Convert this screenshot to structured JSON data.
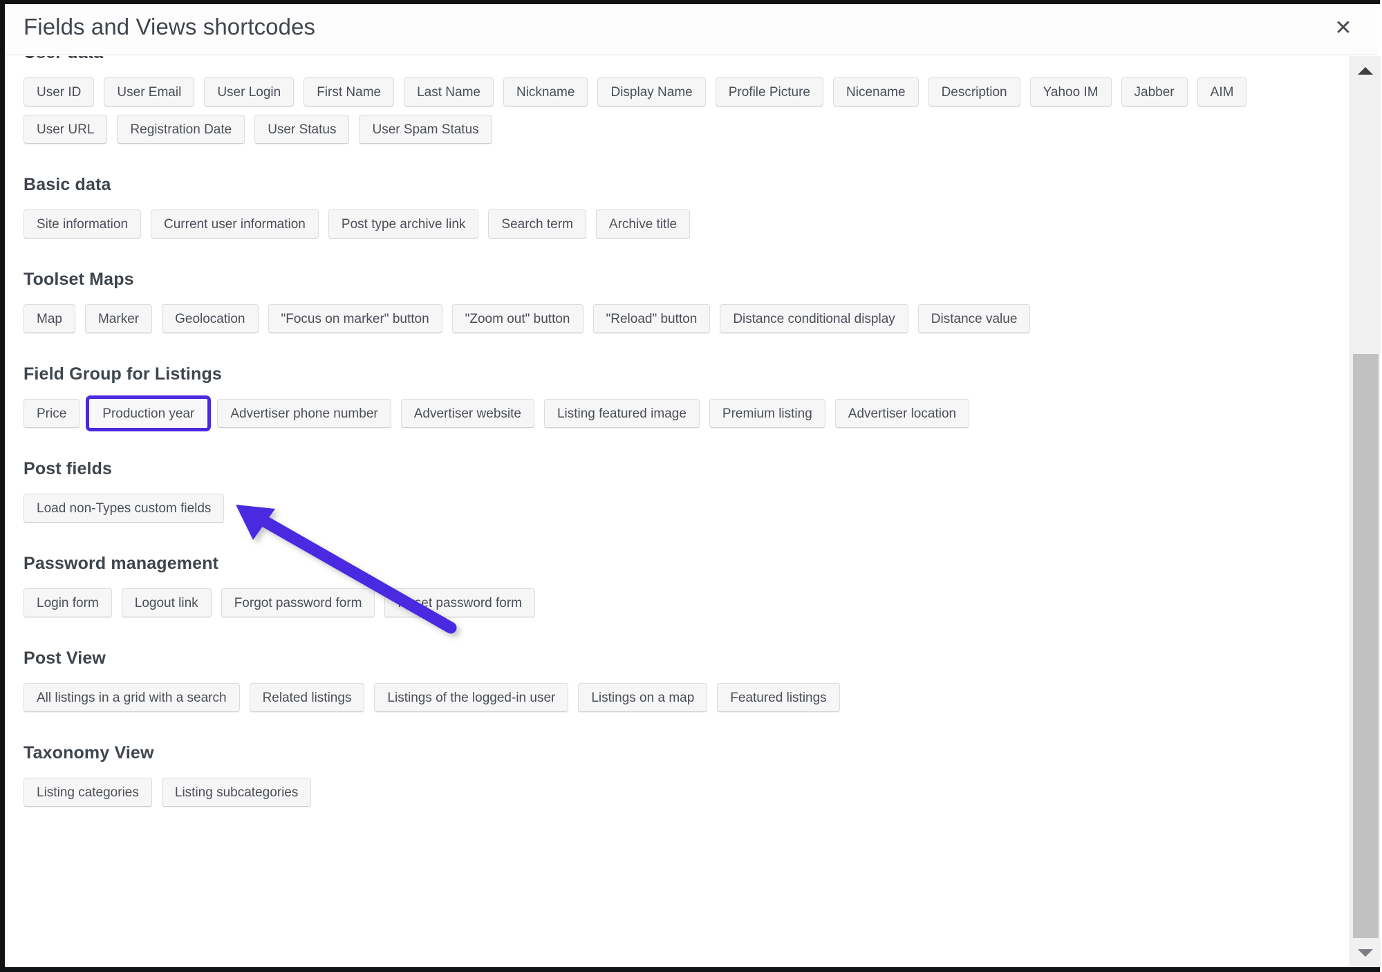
{
  "modal": {
    "title": "Fields and Views shortcodes",
    "close_label": "✕",
    "close_icon": "close-icon"
  },
  "scrollbar": {
    "up_icon": "chevron-up-icon",
    "down_icon": "chevron-down-icon"
  },
  "annotation": {
    "highlight_color": "#4a29e0",
    "arrow_color": "#4a29e0",
    "highlighted_button": "Production year"
  },
  "sections": [
    {
      "title": "User data",
      "buttons": [
        "User ID",
        "User Email",
        "User Login",
        "First Name",
        "Last Name",
        "Nickname",
        "Display Name",
        "Profile Picture",
        "Nicename",
        "Description",
        "Yahoo IM",
        "Jabber",
        "AIM",
        "User URL",
        "Registration Date",
        "User Status",
        "User Spam Status"
      ]
    },
    {
      "title": "Basic data",
      "buttons": [
        "Site information",
        "Current user information",
        "Post type archive link",
        "Search term",
        "Archive title"
      ]
    },
    {
      "title": "Toolset Maps",
      "buttons": [
        "Map",
        "Marker",
        "Geolocation",
        "\"Focus on marker\" button",
        "\"Zoom out\" button",
        "\"Reload\" button",
        "Distance conditional display",
        "Distance value"
      ]
    },
    {
      "title": "Field Group for Listings",
      "buttons": [
        "Price",
        "Production year",
        "Advertiser phone number",
        "Advertiser website",
        "Listing featured image",
        "Premium listing",
        "Advertiser location"
      ],
      "highlighted": "Production year"
    },
    {
      "title": "Post fields",
      "buttons": [
        "Load non-Types custom fields"
      ]
    },
    {
      "title": "Password management",
      "buttons": [
        "Login form",
        "Logout link",
        "Forgot password form",
        "Reset password form"
      ]
    },
    {
      "title": "Post View",
      "buttons": [
        "All listings in a grid with a search",
        "Related listings",
        "Listings of the logged-in user",
        "Listings on a map",
        "Featured listings"
      ]
    },
    {
      "title": "Taxonomy View",
      "buttons": [
        "Listing categories",
        "Listing subcategories"
      ]
    }
  ]
}
